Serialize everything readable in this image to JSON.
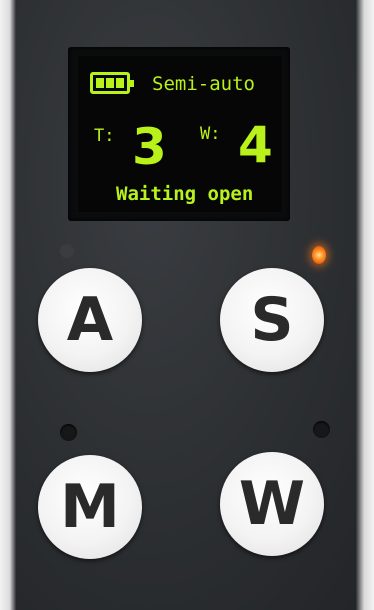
{
  "display": {
    "battery_icon": "battery-full-icon",
    "mode": "Semi-auto",
    "t_label": "T:",
    "t_value": "3",
    "w_label": "W:",
    "w_value": "4",
    "status": "Waiting open"
  },
  "buttons": {
    "a": "A",
    "s": "S",
    "m": "M",
    "w": "W"
  },
  "colors": {
    "oled_text": "#b8f21a",
    "led_on": "#ff8a1e",
    "panel": "#2c2f32"
  }
}
